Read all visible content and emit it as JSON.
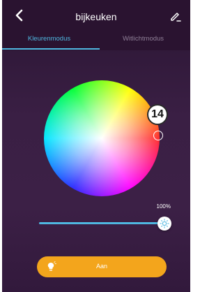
{
  "header": {
    "title": "bijkeuken",
    "back_icon": "chevron-left-icon",
    "edit_icon": "pencil-icon"
  },
  "tabs": [
    {
      "label": "Kleurenmodus",
      "active": true
    },
    {
      "label": "Witlichtmodus",
      "active": false
    }
  ],
  "color_wheel": {
    "selected_value": "14"
  },
  "brightness": {
    "value_label": "100%",
    "value": 100,
    "thumb_icon": "sun-icon"
  },
  "power": {
    "label": "Aan",
    "icon": "lightbulb-icon"
  },
  "colors": {
    "accent": "#4fb7e0",
    "power_button": "#f3a51c",
    "background": "#3a1f44"
  }
}
